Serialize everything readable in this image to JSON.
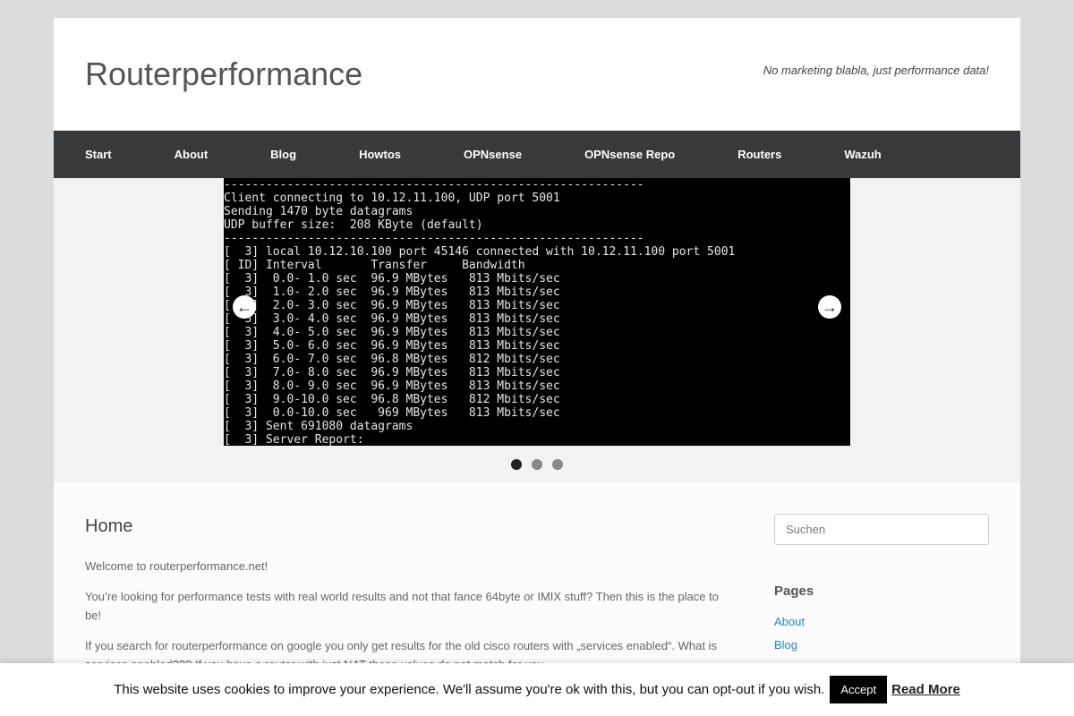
{
  "header": {
    "site_title": "Routerperformance",
    "tagline": "No marketing blabla, just performance data!"
  },
  "nav": {
    "items": [
      "Start",
      "About",
      "Blog",
      "Howtos",
      "OPNsense",
      "OPNsense Repo",
      "Routers",
      "Wazuh"
    ]
  },
  "slider": {
    "terminal_lines": [
      "------------------------------------------------------------",
      "Client connecting to 10.12.11.100, UDP port 5001",
      "Sending 1470 byte datagrams",
      "UDP buffer size:  208 KByte (default)",
      "------------------------------------------------------------",
      "[  3] local 10.12.10.100 port 45146 connected with 10.12.11.100 port 5001",
      "[ ID] Interval       Transfer     Bandwidth",
      "[  3]  0.0- 1.0 sec  96.9 MBytes   813 Mbits/sec",
      "[  3]  1.0- 2.0 sec  96.9 MBytes   813 Mbits/sec",
      "[  3]  2.0- 3.0 sec  96.9 MBytes   813 Mbits/sec",
      "[  3]  3.0- 4.0 sec  96.9 MBytes   813 Mbits/sec",
      "[  3]  4.0- 5.0 sec  96.9 MBytes   813 Mbits/sec",
      "[  3]  5.0- 6.0 sec  96.9 MBytes   813 Mbits/sec",
      "[  3]  6.0- 7.0 sec  96.8 MBytes   812 Mbits/sec",
      "[  3]  7.0- 8.0 sec  96.9 MBytes   813 Mbits/sec",
      "[  3]  8.0- 9.0 sec  96.9 MBytes   813 Mbits/sec",
      "[  3]  9.0-10.0 sec  96.8 MBytes   812 Mbits/sec",
      "[  3]  0.0-10.0 sec   969 MBytes   813 Mbits/sec",
      "[  3] Sent 691080 datagrams",
      "[  3] Server Report:"
    ],
    "prev_icon": "←",
    "next_icon": "→",
    "slide_count": 3,
    "active_slide": 1
  },
  "main": {
    "heading": "Home",
    "paragraphs": [
      "Welcome to routerperformance.net!",
      "You’re looking for performance tests with real world results and not that fance 64byte or IMIX stuff? Then this is the place to be!",
      "If you search for routerperformance on google you only get results for the old cisco routers with „services enabled“. What is services enabled??? If you have a router with just NAT these values do not match for you."
    ]
  },
  "sidebar": {
    "search_placeholder": "Suchen",
    "pages_title": "Pages",
    "pages": [
      "About",
      "Blog"
    ]
  },
  "cookie": {
    "text": "This website uses cookies to improve your experience. We'll assume you're ok with this, but you can opt-out if you wish.",
    "accept_label": "Accept",
    "read_more_label": "Read More"
  }
}
